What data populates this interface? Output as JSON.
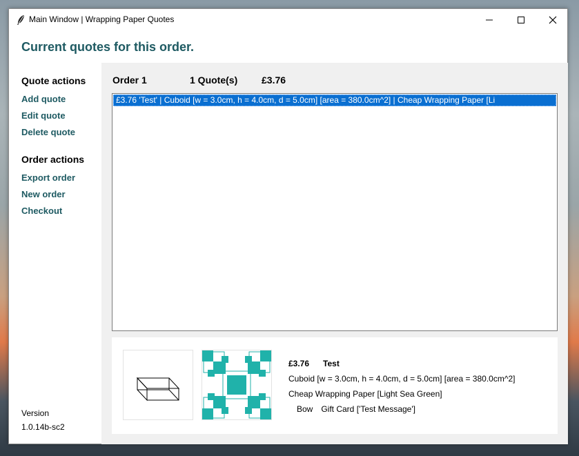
{
  "window": {
    "title": "Main Window | Wrapping Paper Quotes"
  },
  "heading": "Current quotes for this order.",
  "sidebar": {
    "quote_actions_title": "Quote actions",
    "quote_actions": [
      "Add quote",
      "Edit quote",
      "Delete quote"
    ],
    "order_actions_title": "Order actions",
    "order_actions": [
      "Export order",
      "New order",
      "Checkout"
    ]
  },
  "version": {
    "label": "Version",
    "value": "1.0.14b-sc2"
  },
  "order": {
    "name": "Order 1",
    "count": "1 Quote(s)",
    "total": "£3.76"
  },
  "quotes": [
    "£3.76   'Test'   |   Cuboid [w = 3.0cm, h = 4.0cm, d = 5.0cm] [area = 380.0cm^2]   |   Cheap Wrapping Paper [Li"
  ],
  "detail": {
    "price": "£3.76",
    "name": "Test",
    "shape": "Cuboid [w = 3.0cm, h = 4.0cm, d = 5.0cm] [area = 380.0cm^2]",
    "paper": "Cheap Wrapping Paper [Light Sea Green]",
    "bow": "Bow",
    "gift_card": "Gift Card ['Test Message']"
  },
  "colors": {
    "accent": "#1e5a62",
    "selection": "#0a6fd1",
    "paper_pattern": "#20b2aa"
  },
  "icons": [
    "feather-icon",
    "minimize-icon",
    "maximize-icon",
    "close-icon",
    "cuboid-icon",
    "paper-pattern-icon"
  ]
}
